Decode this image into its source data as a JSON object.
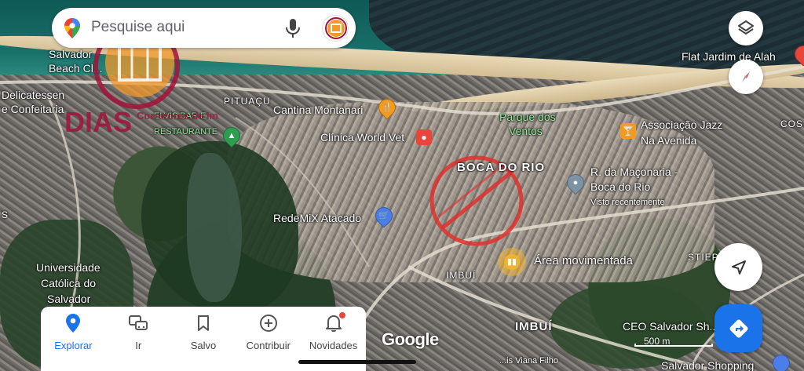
{
  "search": {
    "placeholder": "Pesquise aqui"
  },
  "watermark": {
    "line1": "DIAS",
    "line2": "Corretores de Imóveis"
  },
  "map_labels": {
    "salvador_beach": "Salvador\nBeach Cl...",
    "delicatessen": "Delicatessen",
    "confeitaria": "e Confeitaria",
    "pituacu": "PITUAÇU",
    "cantina": "Cantina Montanari",
    "parque_line1": "Parque dos",
    "parque_line2": "Ventos",
    "associacao_line1": "Associação Jazz",
    "associacao_line2": "Na Avenida",
    "flat": "Flat Jardim de Alah",
    "clinica": "Clínica World Vet",
    "elvis_line1": "ELVIS BAR E",
    "elvis_line2": "RESTAURANTE",
    "boca_do_rio": "BOCA DO RIO",
    "maconaria_line1": "R. da Maçonaria -",
    "maconaria_line2": "Boca do Rio",
    "visto": "Visto recentemente",
    "redemix": "RedeMiX Atacado",
    "area": "Área movimentada",
    "stiep": "STIEP",
    "cos": "COS",
    "universidade_line1": "Universidade",
    "universidade_line2": "Católica do",
    "universidade_line3": "Salvador",
    "imbui1": "IMBUÍ",
    "imbui2": "IMBUÍ",
    "ceo": "CEO Salvador Sh...",
    "luis": "...is Viana Filho",
    "salvador_shopping": "Salvador Shopping",
    "s_left": "S"
  },
  "branding": {
    "google": "Google",
    "scale": "500 m"
  },
  "nav": [
    {
      "label": "Explorar",
      "icon": "explore-pin-icon"
    },
    {
      "label": "Ir",
      "icon": "commute-icon"
    },
    {
      "label": "Salvo",
      "icon": "bookmark-icon"
    },
    {
      "label": "Contribuir",
      "icon": "add-circle-icon"
    },
    {
      "label": "Novidades",
      "icon": "bell-icon"
    }
  ],
  "colors": {
    "accent": "#1a73e8",
    "watermark_orange": "#f39a2b",
    "watermark_red": "#a3123a"
  }
}
